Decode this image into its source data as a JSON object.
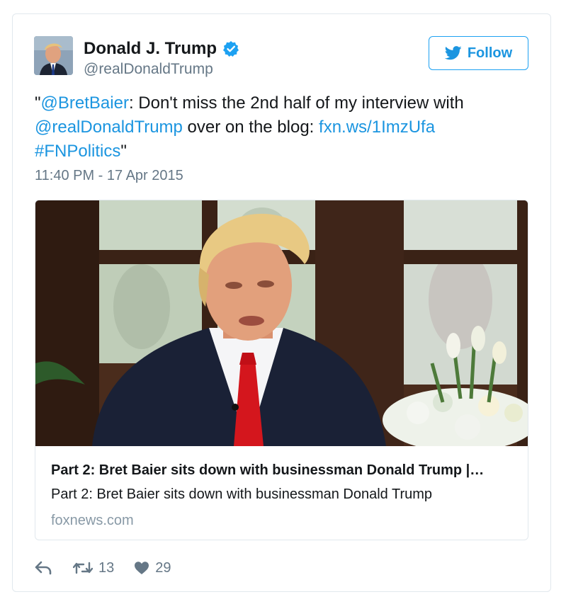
{
  "author": {
    "name": "Donald J. Trump",
    "handle": "@realDonaldTrump",
    "verified_color": "#1da1f2"
  },
  "follow_button": {
    "label": "Follow",
    "icon": "twitter-bird-icon",
    "color": "#1b95e0"
  },
  "tweet": {
    "quote_open": "\"",
    "mention_1": "@BretBaier",
    "text_1": ": Don't miss the 2nd half of my interview with ",
    "mention_2": "@realDonaldTrump",
    "text_2": " over on the blog: ",
    "link": "fxn.ws/1ImzUfa",
    "hashtag": "#FNPolitics",
    "quote_close": "\"",
    "timestamp": "11:40 PM - 17 Apr 2015"
  },
  "card": {
    "title": "Part 2: Bret Baier sits down with businessman Donald Trump |…",
    "description": "Part 2: Bret Baier sits down with businessman Donald Trump",
    "domain": "foxnews.com"
  },
  "actions": {
    "reply_icon": "reply-icon",
    "retweet_icon": "retweet-icon",
    "retweet_count": "13",
    "like_icon": "heart-icon",
    "like_count": "29"
  },
  "colors": {
    "link": "#1b95e0",
    "text": "#14171a",
    "muted": "#657786",
    "border": "#e1e8ed"
  }
}
